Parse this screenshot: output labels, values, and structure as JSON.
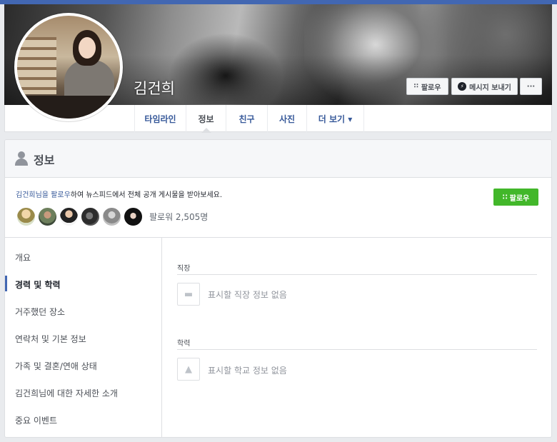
{
  "profile": {
    "name": "김건희"
  },
  "cover_actions": {
    "follow_label": "팔로우",
    "message_label": "메시지 보내기",
    "more_label": "···"
  },
  "tabs": [
    {
      "label": "타임라인"
    },
    {
      "label": "정보"
    },
    {
      "label": "친구"
    },
    {
      "label": "사진"
    },
    {
      "label": "더 보기 ▾"
    }
  ],
  "about": {
    "title": "정보",
    "follow_prompt_link": "김건희님을 팔로우",
    "follow_prompt_rest": "하여 뉴스피드에서 전체 공개 게시물을 받아보세요.",
    "follow_button_label": "팔로우",
    "follower_count": "팔로워 2,505명"
  },
  "sidebar": {
    "items": [
      {
        "label": "개요"
      },
      {
        "label": "경력 및 학력"
      },
      {
        "label": "거주했던 장소"
      },
      {
        "label": "연락처 및 기본 정보"
      },
      {
        "label": "가족 및 결혼/연애 상태"
      },
      {
        "label": "김건희님에 대한 자세한 소개"
      },
      {
        "label": "중요 이벤트"
      }
    ],
    "active_index": 1
  },
  "sections": {
    "work": {
      "label": "직장",
      "empty_text": "표시할 직장 정보 없음",
      "icon": "briefcase-icon"
    },
    "education": {
      "label": "학력",
      "empty_text": "표시할 학교 정보 없음",
      "icon": "graduation-cap-icon"
    }
  },
  "colors": {
    "facebook_blue": "#4267b2",
    "link_blue": "#365899",
    "follow_green": "#42b72a",
    "page_bg": "#e9ebee"
  }
}
